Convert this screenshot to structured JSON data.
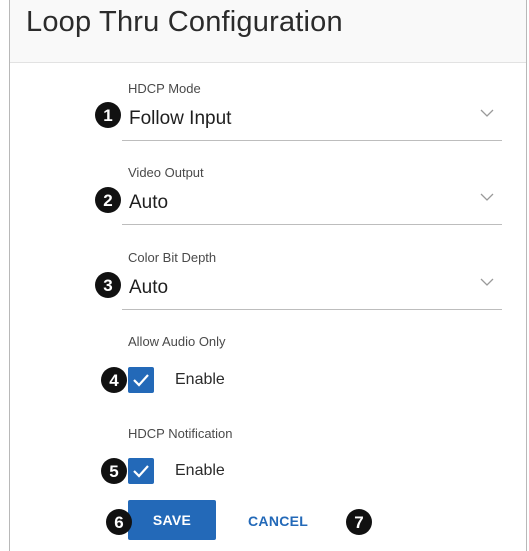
{
  "dialog": {
    "title": "Loop Thru Configuration"
  },
  "fields": [
    {
      "label": "HDCP Mode",
      "value": "Follow Input",
      "marker": "1"
    },
    {
      "label": "Video Output",
      "value": "Auto",
      "marker": "2"
    },
    {
      "label": "Color Bit Depth",
      "value": "Auto",
      "marker": "3"
    }
  ],
  "toggles": [
    {
      "label": "Allow Audio Only",
      "option": "Enable",
      "checked": true,
      "marker": "4"
    },
    {
      "label": "HDCP Notification",
      "option": "Enable",
      "checked": true,
      "marker": "5"
    }
  ],
  "actions": {
    "save_label": "SAVE",
    "save_marker": "6",
    "cancel_label": "CANCEL",
    "cancel_marker": "7"
  },
  "colors": {
    "accent": "#2369b8",
    "marker_bg": "#111111",
    "divider": "#bdbdbd"
  }
}
